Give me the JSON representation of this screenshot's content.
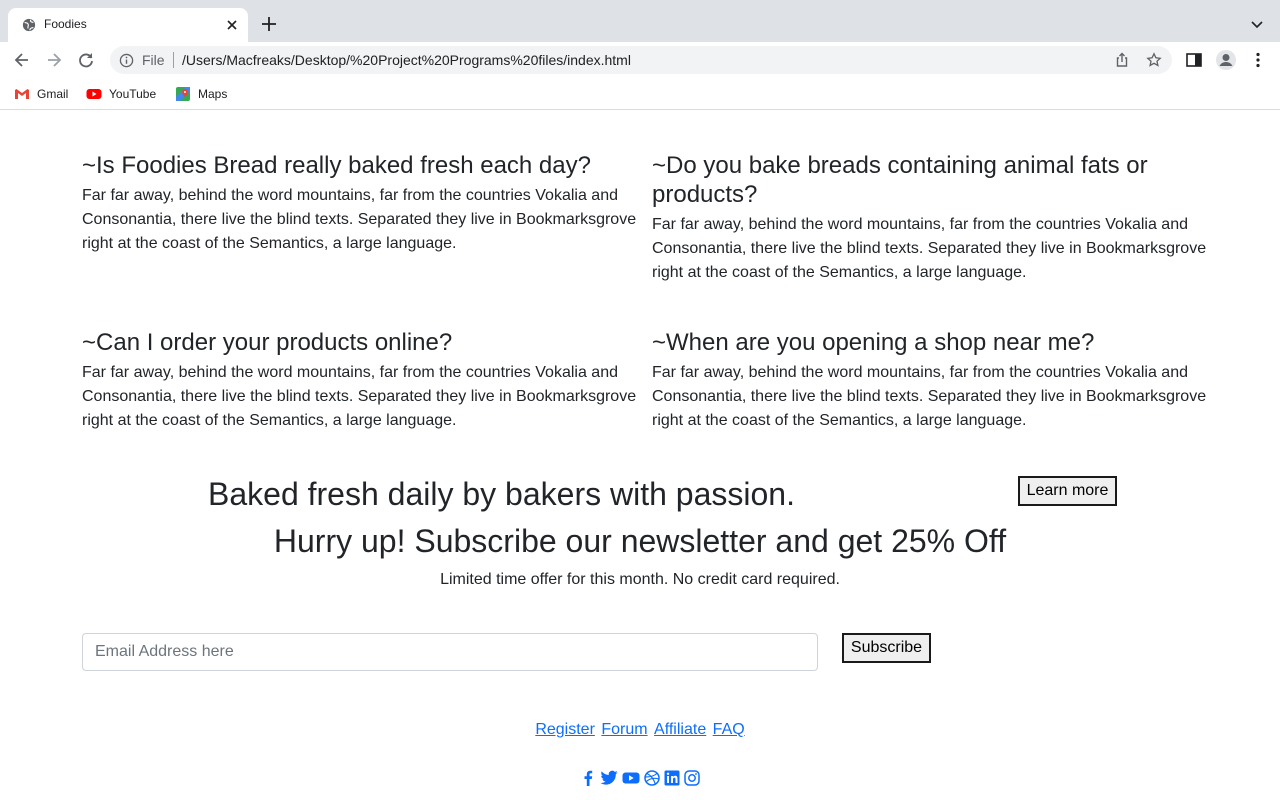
{
  "browser": {
    "tab_title": "Foodies",
    "scheme": "File",
    "url": "/Users/Macfreaks/Desktop/%20Project%20Programs%20files/index.html",
    "bookmarks": [
      "Gmail",
      "YouTube",
      "Maps"
    ]
  },
  "faq": [
    {
      "question": "~Is Foodies Bread really baked fresh each day?",
      "answer": "Far far away, behind the word mountains, far from the countries Vokalia and Consonantia, there live the blind texts. Separated they live in Bookmarksgrove right at the coast of the Semantics, a large language."
    },
    {
      "question": "~Do you bake breads containing animal fats or products?",
      "answer": "Far far away, behind the word mountains, far from the countries Vokalia and Consonantia, there live the blind texts. Separated they live in Bookmarksgrove right at the coast of the Semantics, a large language."
    },
    {
      "question": "~Can I order your products online?",
      "answer": "Far far away, behind the word mountains, far from the countries Vokalia and Consonantia, there live the blind texts. Separated they live in Bookmarksgrove right at the coast of the Semantics, a large language."
    },
    {
      "question": "~When are you opening a shop near me?",
      "answer": "Far far away, behind the word mountains, far from the countries Vokalia and Consonantia, there live the blind texts. Separated they live in Bookmarksgrove right at the coast of the Semantics, a large language."
    }
  ],
  "hero": {
    "headline": "Baked fresh daily by bakers with passion.",
    "button": "Learn more"
  },
  "newsletter": {
    "title": "Hurry up! Subscribe our newsletter and get 25% Off",
    "subtitle": "Limited time offer for this month. No credit card required.",
    "placeholder": "Email Address here",
    "button": "Subscribe"
  },
  "footer": {
    "links": [
      "Register",
      "Forum",
      "Affiliate",
      "FAQ"
    ],
    "social_icons": [
      "facebook-icon",
      "twitter-icon",
      "youtube-icon",
      "dribbble-icon",
      "linkedin-icon",
      "instagram-icon"
    ]
  },
  "colors": {
    "link": "#0d6efd",
    "text": "#212529",
    "tabstrip": "#dee1e6"
  }
}
